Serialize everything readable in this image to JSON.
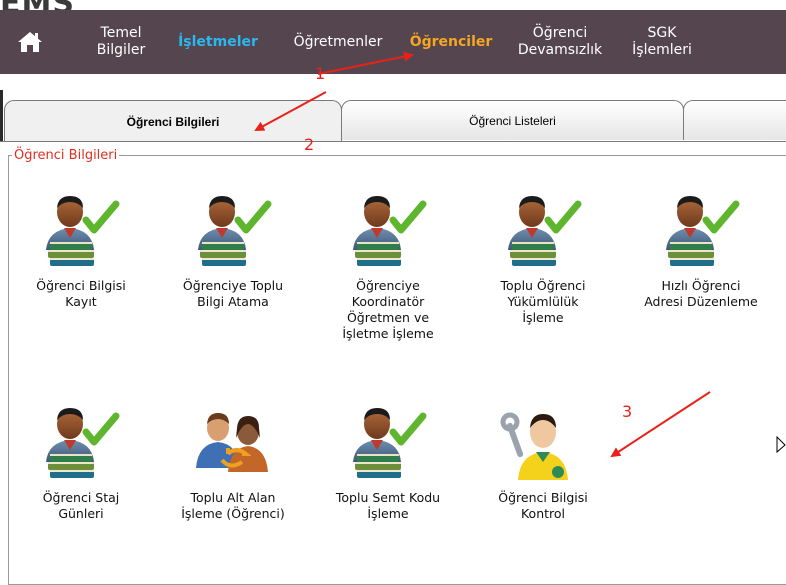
{
  "header": {
    "logo_text": "EMS"
  },
  "nav": {
    "home_icon": "home-icon",
    "items": [
      {
        "line1": "Temel",
        "line2": "Bilgiler",
        "color": "#ffffff"
      },
      {
        "line1": "İşletmeler",
        "line2": "",
        "color": "#29b8f0"
      },
      {
        "line1": "Öğretmenler",
        "line2": "",
        "color": "#ffffff"
      },
      {
        "line1": "Öğrenciler",
        "line2": "",
        "color": "#f5a623"
      },
      {
        "line1": "Öğrenci",
        "line2": "Devamsızlık",
        "color": "#ffffff"
      },
      {
        "line1": "SGK",
        "line2": "İşlemleri",
        "color": "#ffffff"
      }
    ]
  },
  "tabs": [
    {
      "label": "Öğrenci Bilgileri",
      "active": true
    },
    {
      "label": "Öğrenci Listeleri",
      "active": false
    },
    {
      "label": "",
      "active": false
    }
  ],
  "section": {
    "legend": "Öğrenci Bilgileri"
  },
  "tiles": [
    {
      "label": "Öğrenci Bilgisi\nKayıt",
      "icon": "student-books-check-icon"
    },
    {
      "label": "Öğrenciye Toplu\nBilgi Atama",
      "icon": "student-books-check-icon"
    },
    {
      "label": "Öğrenciye\nKoordinatör\nÖğretmen ve\nİşletme İşleme",
      "icon": "student-books-check-icon"
    },
    {
      "label": "Toplu Öğrenci\nYükümlülük\nİşleme",
      "icon": "student-books-check-icon"
    },
    {
      "label": "Hızlı Öğrenci\nAdresi Düzenleme",
      "icon": "student-books-check-icon"
    },
    {
      "label": "Öğrenci Staj\nGünleri",
      "icon": "student-books-check-icon"
    },
    {
      "label": "Toplu Alt Alan\nİşleme (Öğrenci)",
      "icon": "users-exchange-icon"
    },
    {
      "label": "Toplu Semt Kodu\nİşleme",
      "icon": "student-books-check-icon"
    },
    {
      "label": "Öğrenci Bilgisi\nKontrol",
      "icon": "person-wrench-icon"
    }
  ],
  "annotations": [
    "1",
    "2",
    "3"
  ],
  "colors": {
    "nav_bg": "#55454e",
    "annotation": "#e8221a",
    "legend": "#e03020"
  }
}
